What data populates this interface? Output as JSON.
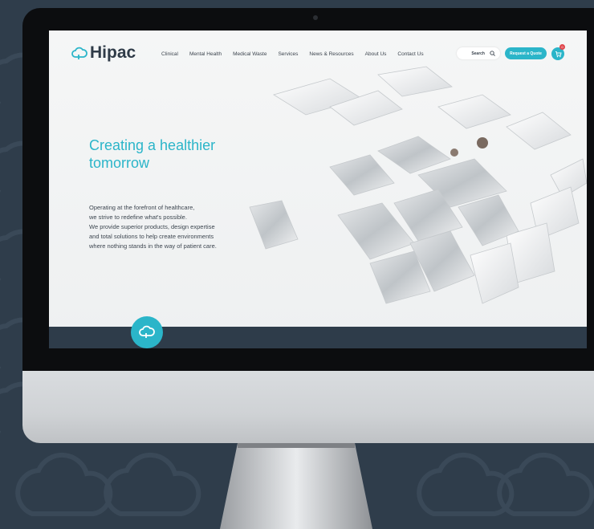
{
  "brand": {
    "name": "Hipac",
    "accent": "#2bb5c9",
    "dark": "#2e3c4a"
  },
  "nav": {
    "links": [
      "Clinical",
      "Mental Health",
      "Medical Waste",
      "Services",
      "News & Resources",
      "About Us",
      "Contact Us"
    ],
    "search_label": "Search",
    "request_label": "Request a Quote",
    "cart_count": "0"
  },
  "hero": {
    "title": "Creating a healthier tomorrow",
    "paragraph_lines": [
      "Operating at the forefront of healthcare,",
      "we strive to redefine what's possible.",
      "We provide superior products, design expertise",
      "and total solutions to help create environments",
      "where nothing stands in the way of patient care."
    ]
  },
  "icons": {
    "logo": "cloud-logo-icon",
    "search": "search-icon",
    "cart": "cart-icon",
    "footer": "cloud-badge-icon"
  }
}
